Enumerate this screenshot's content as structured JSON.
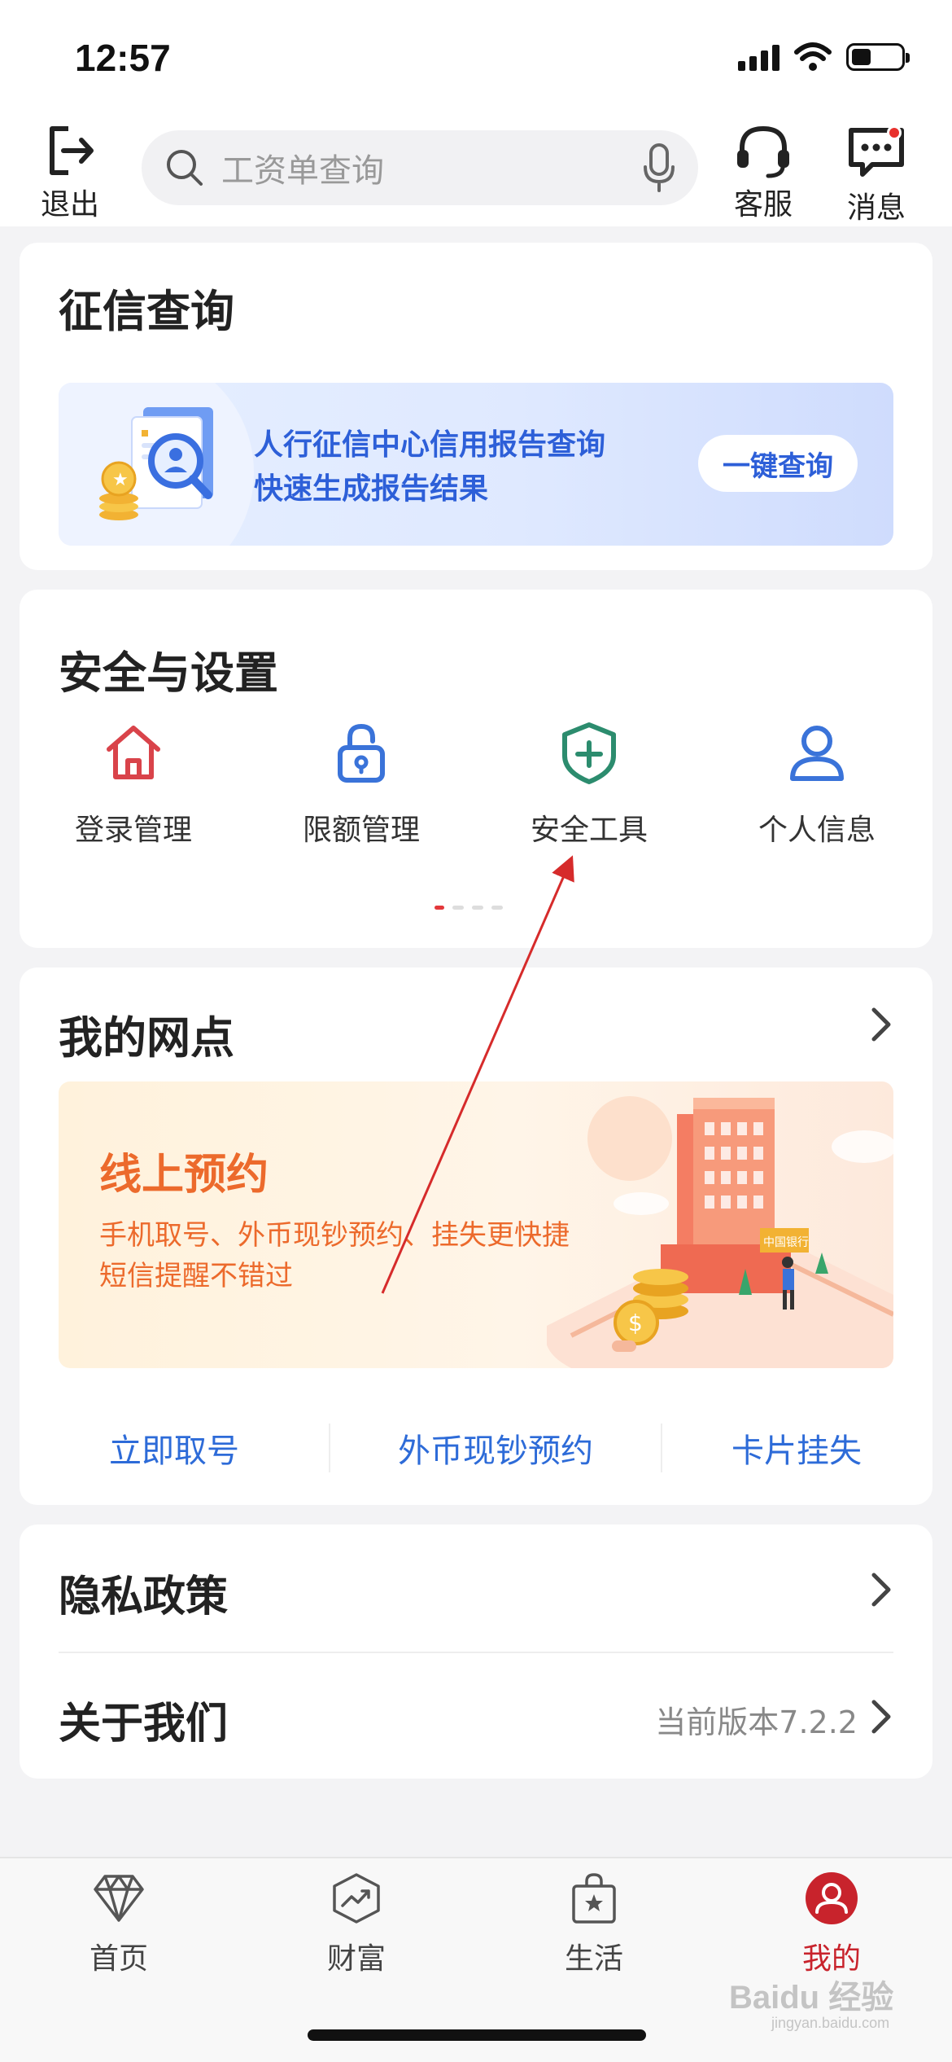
{
  "status": {
    "time": "12:57"
  },
  "top_bar": {
    "logout_label": "退出",
    "search_placeholder": "工资单查询",
    "service_label": "客服",
    "message_label": "消息"
  },
  "credit": {
    "title": "征信查询",
    "line1": "人行征信中心信用报告查询",
    "line2": "快速生成报告结果",
    "button": "一键查询"
  },
  "security": {
    "title": "安全与设置",
    "items": [
      {
        "label": "登录管理",
        "icon": "house-icon",
        "color": "#d9434a"
      },
      {
        "label": "限额管理",
        "icon": "lock-icon",
        "color": "#3a73d9"
      },
      {
        "label": "安全工具",
        "icon": "shield-plus-icon",
        "color": "#2c8c6e"
      },
      {
        "label": "个人信息",
        "icon": "person-icon",
        "color": "#3a73d9"
      }
    ]
  },
  "branch": {
    "title": "我的网点",
    "banner_title": "线上预约",
    "banner_line1": "手机取号、外币现钞预约、挂失更快捷",
    "banner_line2": "短信提醒不错过",
    "bank_sign": "中国银行",
    "links": [
      "立即取号",
      "外币现钞预约",
      "卡片挂失"
    ]
  },
  "info": {
    "privacy": "隐私政策",
    "about": "关于我们",
    "version": "当前版本7.2.2"
  },
  "tabbar": {
    "tabs": [
      {
        "label": "首页",
        "icon": "diamond-icon"
      },
      {
        "label": "财富",
        "icon": "wealth-chart-icon"
      },
      {
        "label": "生活",
        "icon": "shopping-bag-icon"
      },
      {
        "label": "我的",
        "icon": "profile-icon",
        "active": true
      }
    ]
  },
  "watermark": {
    "brand": "Baidu 经验",
    "domain": "jingyan.baidu.com"
  },
  "colors": {
    "accent_red": "#c8232c",
    "link_blue": "#2d6bd8",
    "orange": "#ec6a2c"
  }
}
